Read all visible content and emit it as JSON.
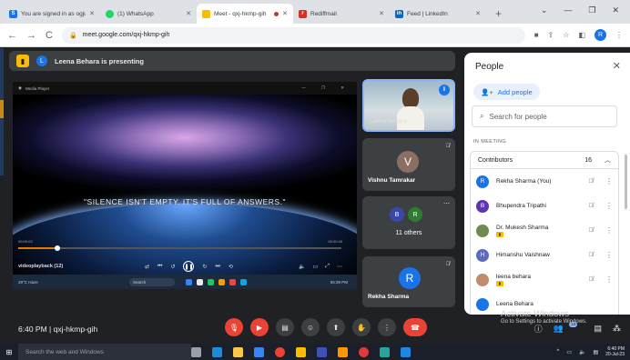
{
  "browser": {
    "tabs": [
      {
        "title": "You are signed in as ogju388",
        "fav_color": "#1a73e8",
        "fav_glyph": "S"
      },
      {
        "title": "(1) WhatsApp",
        "fav_color": "#25d366",
        "fav_glyph": ""
      },
      {
        "title": "Meet - qxj-hkmp-gih",
        "fav_color": "#fbbc04",
        "fav_glyph": "",
        "active": true
      },
      {
        "title": "Rediffmail",
        "fav_color": "#d93025",
        "fav_glyph": "r"
      },
      {
        "title": "Feed | LinkedIn",
        "fav_color": "#0a66c2",
        "fav_glyph": "in"
      }
    ],
    "new_tab": "+",
    "url": "meet.google.com/qxj-hkmp-gih",
    "profile_initial": "R"
  },
  "presenting": {
    "presenter_initial": "L",
    "text": "Leena Behara is presenting"
  },
  "share": {
    "player_title": "Media Player",
    "quote": "\"SILENCE ISN'T EMPTY. IT'S FULL OF ANSWERS.\"",
    "time_left": "00:00:03",
    "time_right": "00:00:45",
    "progress": 0.12,
    "video_title": "videoplayback (12)",
    "inner_search": "Search",
    "weather": "29°C Haze",
    "inner_clock": "06:39 PM"
  },
  "tiles": {
    "self_name": "Leena Behara",
    "vishnu": {
      "initial": "V",
      "name": "Vishnu Tamrakar",
      "color": "#8d6e63"
    },
    "others": {
      "initials": [
        "B",
        "R"
      ],
      "colors": [
        "#3949ab",
        "#2e7d32"
      ],
      "label": "11 others"
    },
    "rekha": {
      "initial": "R",
      "name": "Rekha Sharma",
      "color": "#1a73e8"
    }
  },
  "people": {
    "title": "People",
    "add_people": "Add people",
    "search_placeholder": "Search for people",
    "in_meeting": "IN MEETING",
    "contributors_label": "Contributors",
    "contributors_count": "16",
    "members": [
      {
        "name": "Rekha Sharma (You)",
        "initial": "R",
        "color": "#1a73e8",
        "host": false
      },
      {
        "name": "Bhupendra Tripathi",
        "initial": "B",
        "color": "#5e35b1",
        "host": false
      },
      {
        "name": "Dr. Mukesh Sharma",
        "initial": "",
        "color": "#6d8b4f",
        "host": true
      },
      {
        "name": "Himanshu Vaishnaw",
        "initial": "H",
        "color": "#5c6bc0",
        "host": false
      },
      {
        "name": "leena behara",
        "initial": "",
        "color": "#c28b6a",
        "host": true
      },
      {
        "name": "Leena Behara",
        "initial": "",
        "color": "#1a73e8",
        "host": false
      }
    ]
  },
  "bottom": {
    "meeting_info": "6:40 PM  |  qxj-hkmp-gih",
    "participants_badge": "16"
  },
  "watermark": {
    "line1": "Activate Windows",
    "line2": "Go to Settings to activate Windows."
  },
  "taskbar": {
    "search": "Search the web and Windows",
    "time": "6:40 PM",
    "date": "20-Jul-23"
  }
}
